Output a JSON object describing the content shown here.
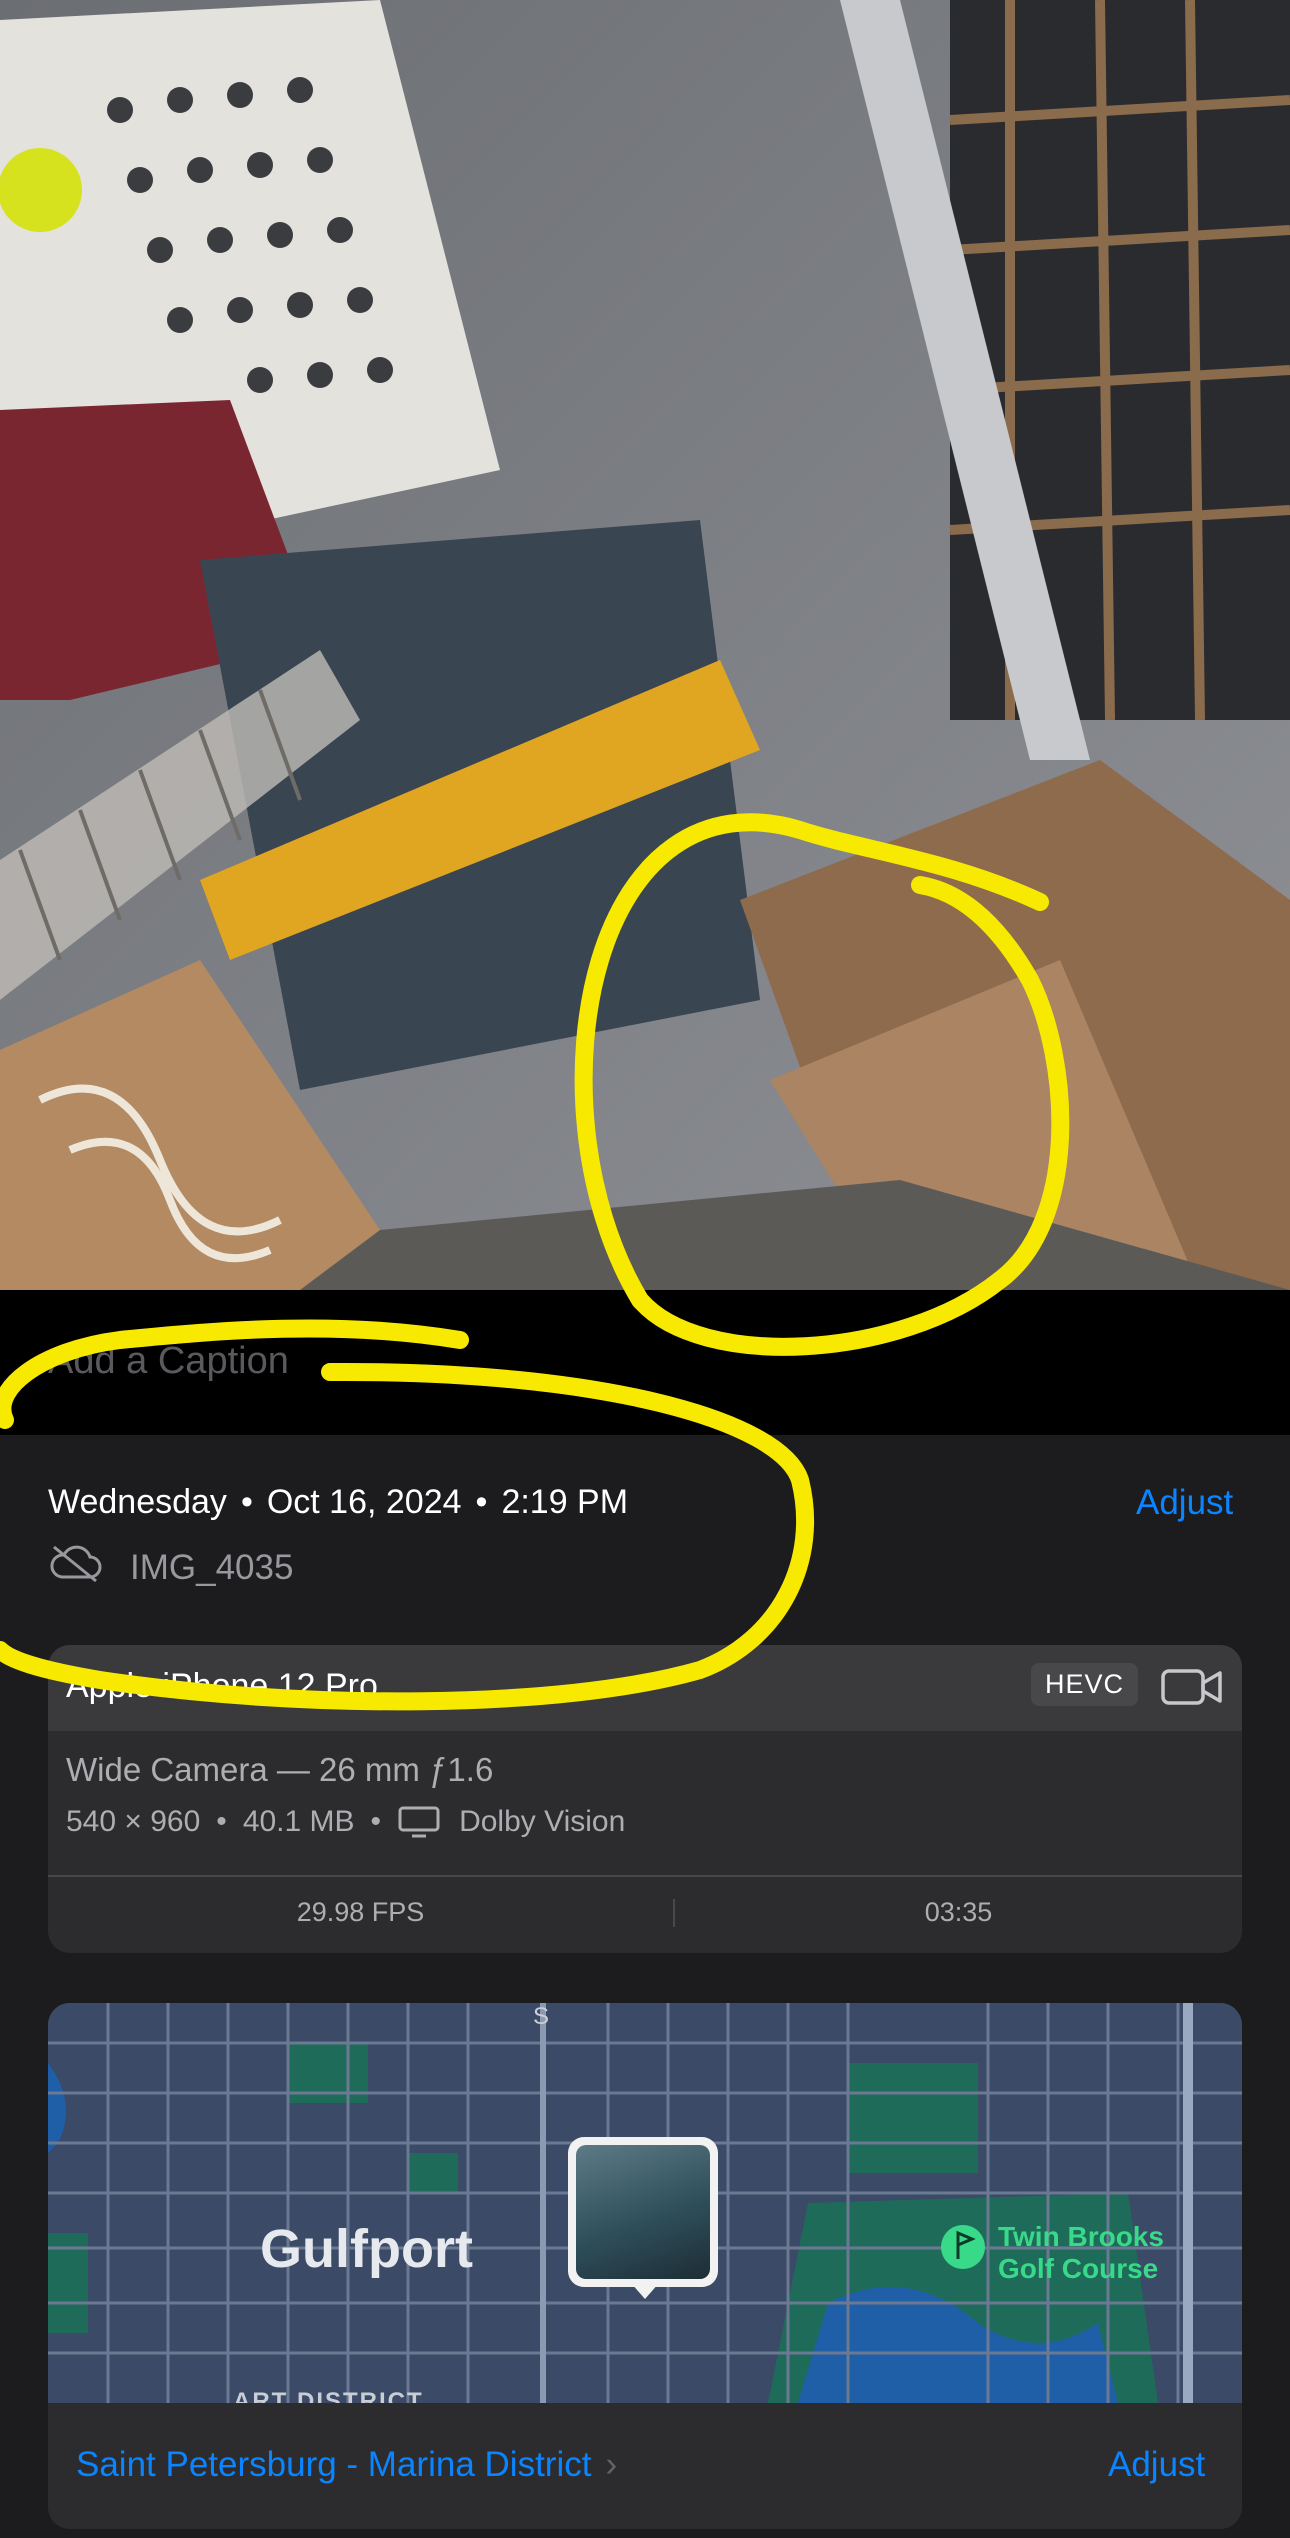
{
  "caption": {
    "placeholder": "Add a Caption"
  },
  "details": {
    "day": "Wednesday",
    "date": "Oct 16, 2024",
    "time": "2:19 PM",
    "separator": "•",
    "adjust_label": "Adjust",
    "file_name": "IMG_4035",
    "cloud_icon": "cloud-slash-icon"
  },
  "metadata": {
    "device": "Apple iPhone 12 Pro",
    "format_badge": "HEVC",
    "video_icon": "video-camera-icon",
    "lens": "Wide Camera — 26 mm ƒ1.6",
    "resolution": "540 × 960",
    "file_size": "40.1 MB",
    "display_icon": "display-icon",
    "hdr": "Dolby Vision",
    "fps": "29.98 FPS",
    "duration": "03:35"
  },
  "map": {
    "city": "Gulfport",
    "poi_line1": "Twin Brooks",
    "poi_line2": "Golf Course",
    "street": "S",
    "district": "ART DISTRICT",
    "location": "Saint Petersburg - Marina District",
    "adjust_label": "Adjust",
    "colors": {
      "water": "#1f5fa8",
      "park": "#1f6b5a",
      "roads": "#6b7a92",
      "poi": "#39d98a"
    }
  },
  "annotation": {
    "color": "#f7ea00"
  }
}
